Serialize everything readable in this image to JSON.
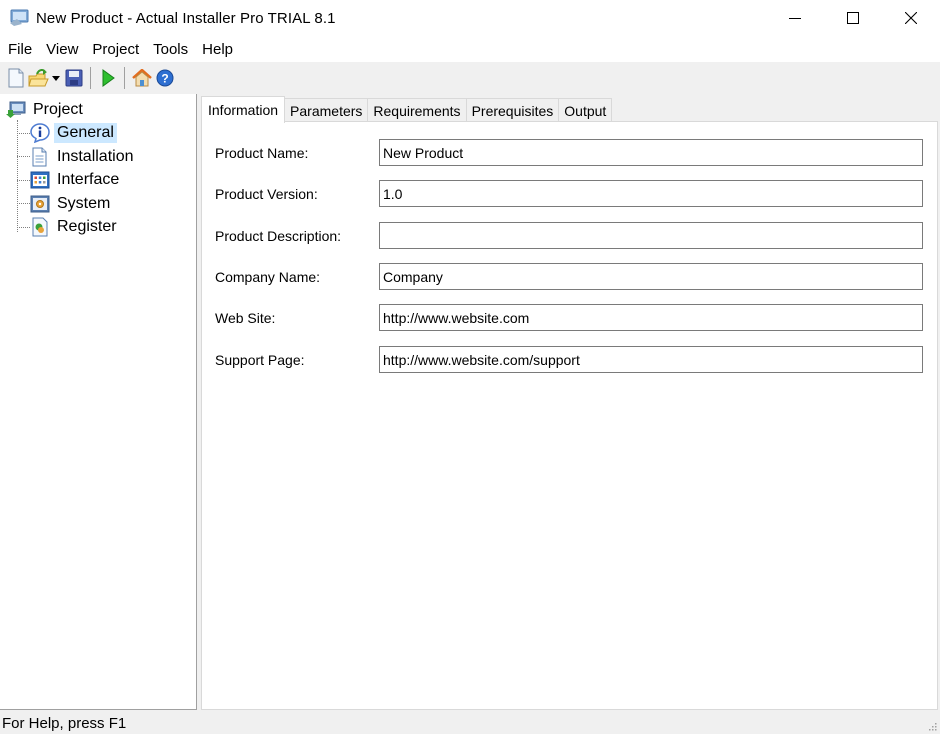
{
  "window": {
    "title": "New Product - Actual Installer Pro TRIAL 8.1",
    "controls": {
      "minimize": "minimize",
      "maximize": "maximize",
      "close": "close"
    }
  },
  "menu": {
    "items": [
      {
        "label": "File"
      },
      {
        "label": "View"
      },
      {
        "label": "Project"
      },
      {
        "label": "Tools"
      },
      {
        "label": "Help"
      }
    ]
  },
  "toolbar": {
    "buttons": [
      {
        "icon": "new-file-icon",
        "tooltip": "New"
      },
      {
        "icon": "open-folder-icon",
        "tooltip": "Open"
      },
      {
        "icon": "save-icon",
        "tooltip": "Save"
      },
      {
        "icon": "run-build-icon",
        "tooltip": "Build"
      },
      {
        "icon": "home-icon",
        "tooltip": "Home"
      },
      {
        "icon": "help-icon",
        "tooltip": "Help"
      }
    ]
  },
  "tree": {
    "root": {
      "label": "Project",
      "icon": "computer-icon"
    },
    "items": [
      {
        "label": "General",
        "icon": "info-icon",
        "selected": true
      },
      {
        "label": "Installation",
        "icon": "document-icon",
        "selected": false
      },
      {
        "label": "Interface",
        "icon": "window-grid-icon",
        "selected": false
      },
      {
        "label": "System",
        "icon": "system-gear-icon",
        "selected": false
      },
      {
        "label": "Register",
        "icon": "register-icon",
        "selected": false
      }
    ]
  },
  "tabs": [
    {
      "label": "Information",
      "active": true
    },
    {
      "label": "Parameters",
      "active": false
    },
    {
      "label": "Requirements",
      "active": false
    },
    {
      "label": "Prerequisites",
      "active": false
    },
    {
      "label": "Output",
      "active": false
    }
  ],
  "form": {
    "fields": [
      {
        "label": "Product Name:",
        "value": "New Product"
      },
      {
        "label": "Product Version:",
        "value": "1.0"
      },
      {
        "label": "Product Description:",
        "value": ""
      },
      {
        "label": "Company Name:",
        "value": "Company"
      },
      {
        "label": "Web Site:",
        "value": "http://www.website.com"
      },
      {
        "label": "Support Page:",
        "value": "http://www.website.com/support"
      }
    ]
  },
  "status": {
    "text": "For Help, press F1"
  }
}
